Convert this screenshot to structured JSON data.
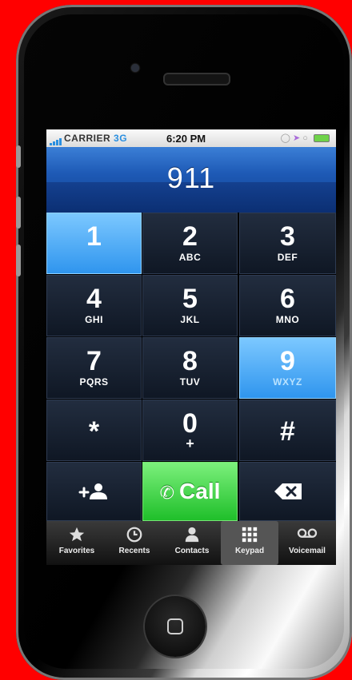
{
  "status_bar": {
    "carrier": "CARRIER",
    "network": "3G",
    "time": "6:20 PM"
  },
  "dialed_number": "911",
  "keys": [
    {
      "digit": "1",
      "letters": "",
      "active": true
    },
    {
      "digit": "2",
      "letters": "ABC",
      "active": false
    },
    {
      "digit": "3",
      "letters": "DEF",
      "active": false
    },
    {
      "digit": "4",
      "letters": "GHI",
      "active": false
    },
    {
      "digit": "5",
      "letters": "JKL",
      "active": false
    },
    {
      "digit": "6",
      "letters": "MNO",
      "active": false
    },
    {
      "digit": "7",
      "letters": "PQRS",
      "active": false
    },
    {
      "digit": "8",
      "letters": "TUV",
      "active": false
    },
    {
      "digit": "9",
      "letters": "WXYZ",
      "active": true
    },
    {
      "digit": "*",
      "letters": "",
      "active": false
    },
    {
      "digit": "0",
      "letters": "+",
      "active": false
    },
    {
      "digit": "#",
      "letters": "",
      "active": false
    }
  ],
  "actions": {
    "add_contact_icon": "add-contact-icon",
    "call_label": "Call",
    "call_icon": "phone-icon",
    "delete_icon": "backspace-icon"
  },
  "tabs": [
    {
      "label": "Favorites",
      "icon": "star-icon",
      "active": false
    },
    {
      "label": "Recents",
      "icon": "clock-icon",
      "active": false
    },
    {
      "label": "Contacts",
      "icon": "person-icon",
      "active": false
    },
    {
      "label": "Keypad",
      "icon": "keypad-icon",
      "active": true
    },
    {
      "label": "Voicemail",
      "icon": "voicemail-icon",
      "active": false
    }
  ],
  "colors": {
    "background": "#ff0000",
    "active_key": "#2f95ee",
    "call_button": "#1fbf2a"
  }
}
